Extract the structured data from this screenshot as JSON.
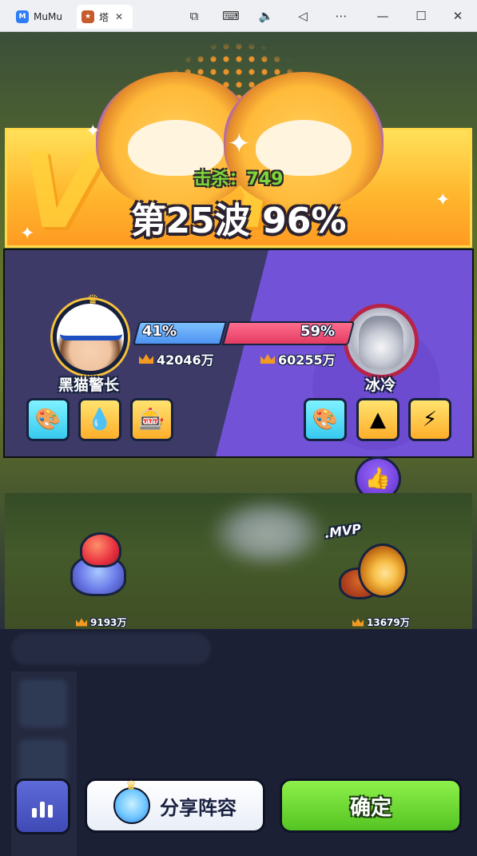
{
  "window": {
    "tabs": [
      {
        "label": "MuMu",
        "icon": "mumu-app-icon"
      },
      {
        "label": "塔",
        "icon": "game-app-icon"
      }
    ],
    "toolbar_icons": [
      "screenshot-icon",
      "keyboard-icon",
      "volume-icon",
      "back-icon",
      "more-icon",
      "minimize-icon",
      "maximize-icon",
      "close-icon"
    ]
  },
  "result": {
    "kills_label": "击杀：749",
    "wave_label": "第25波 96%"
  },
  "players": {
    "left": {
      "name": "黑猫警长",
      "percent": "41%",
      "power": "42046万",
      "share": 0.41
    },
    "right": {
      "name": "冰冷",
      "percent": "59%",
      "power": "60255万",
      "share": 0.59
    }
  },
  "units": {
    "left_power": "9193万",
    "right_power": "13679万",
    "mvp_label": ".MVP"
  },
  "buttons": {
    "share_label": "分享阵容",
    "confirm_label": "确定"
  },
  "colors": {
    "left_bar": "#4d93f0",
    "right_bar": "#e33c62",
    "confirm": "#54c422",
    "panel_right": "#7253d8"
  }
}
